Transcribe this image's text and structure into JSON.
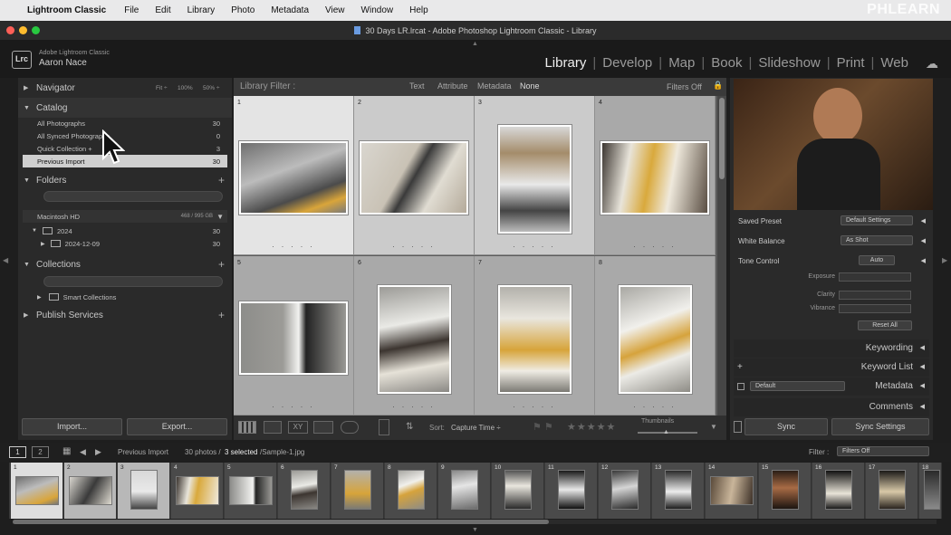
{
  "menubar": {
    "app": "Lightroom Classic",
    "items": [
      "File",
      "Edit",
      "Library",
      "Photo",
      "Metadata",
      "View",
      "Window",
      "Help"
    ],
    "watermark": "PHLEARN"
  },
  "window": {
    "title": "30 Days LR.lrcat - Adobe Photoshop Lightroom Classic - Library"
  },
  "identity": {
    "logo": "Lrc",
    "product": "Adobe Lightroom Classic",
    "user": "Aaron Nace"
  },
  "modules": [
    "Library",
    "Develop",
    "Map",
    "Book",
    "Slideshow",
    "Print",
    "Web"
  ],
  "active_module": "Library",
  "left": {
    "navigator": {
      "title": "Navigator",
      "fit": "Fit ÷",
      "z100": "100%",
      "z50": "50% ÷"
    },
    "catalog": {
      "title": "Catalog",
      "items": [
        {
          "label": "All Photographs",
          "count": "30"
        },
        {
          "label": "All Synced Photographs",
          "count": "0"
        },
        {
          "label": "Quick Collection +",
          "count": "3"
        },
        {
          "label": "Previous Import",
          "count": "30"
        }
      ]
    },
    "folders": {
      "title": "Folders",
      "volume": "Macintosh HD",
      "volume_space": "468 / 995 GB",
      "items": [
        {
          "label": "2024",
          "count": "30"
        },
        {
          "label": "2024-12-09",
          "count": "30"
        }
      ]
    },
    "collections": {
      "title": "Collections",
      "items": [
        {
          "label": "Smart Collections"
        }
      ]
    },
    "publish": {
      "title": "Publish Services"
    },
    "import_label": "Import...",
    "export_label": "Export..."
  },
  "filter": {
    "title": "Library Filter :",
    "tabs": [
      "Text",
      "Attribute",
      "Metadata",
      "None"
    ],
    "status": "Filters Off"
  },
  "grid": {
    "cells": [
      {
        "num": "1"
      },
      {
        "num": "2"
      },
      {
        "num": "3"
      },
      {
        "num": "4"
      },
      {
        "num": "5"
      },
      {
        "num": "6"
      },
      {
        "num": "7"
      },
      {
        "num": "8"
      }
    ],
    "dots": ". . . . ."
  },
  "toolbar": {
    "sort_label": "Sort:",
    "sort_value": "Capture Time ÷",
    "thumbnails_label": "Thumbnails"
  },
  "quick_develop": {
    "saved_preset": {
      "label": "Saved Preset",
      "value": "Default Settings"
    },
    "white_balance": {
      "label": "White Balance",
      "value": "As Shot"
    },
    "tone_control": {
      "label": "Tone Control",
      "value": "Auto"
    },
    "sliders": [
      "Exposure",
      "Clarity",
      "Vibrance"
    ],
    "reset": "Reset All"
  },
  "right_sections": {
    "keywording": "Keywording",
    "keyword_list": "Keyword List",
    "metadata": "Metadata",
    "metadata_preset": "Default",
    "comments": "Comments"
  },
  "sync": {
    "sync": "Sync",
    "sync_settings": "Sync Settings"
  },
  "filmstrip": {
    "page1": "1",
    "page2": "2",
    "source": "Previous Import",
    "info_prefix": "30 photos /",
    "selected": "3 selected",
    "filename": "/Sample-1.jpg",
    "filter_label": "Filter :",
    "filter_value": "Filters Off",
    "thumbs": [
      "1",
      "2",
      "3",
      "4",
      "5",
      "6",
      "7",
      "8",
      "9",
      "10",
      "11",
      "12",
      "13",
      "14",
      "15",
      "16",
      "17",
      "18"
    ]
  },
  "colors": {
    "selected_cell": "#e4e4e4",
    "grid_bg": "#a9a9a9",
    "panel": "#2a2a2a"
  }
}
